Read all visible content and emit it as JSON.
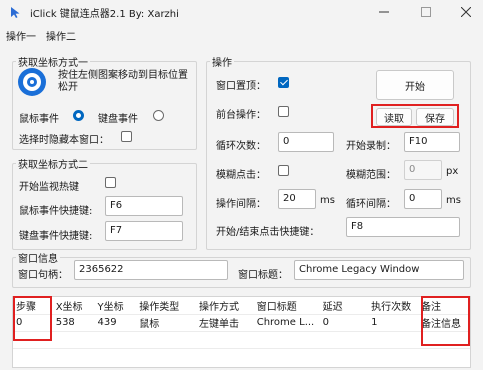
{
  "window": {
    "title": "iClick 键鼠连点器2.1 By:  Xarzhi"
  },
  "menu": [
    "操作一",
    "操作二"
  ],
  "coord_group1": {
    "legend": "获取坐标方式一",
    "drag_hint": "按住左侧图案移动到目标位置松开",
    "mouse_event_label": "鼠标事件",
    "keyboard_event_label": "键盘事件",
    "hide_window_label": "选择时隐藏本窗口：",
    "mouse_event_selected": true,
    "keyboard_event_selected": false,
    "hide_window_checked": false
  },
  "coord_group2": {
    "legend": "获取坐标方式二",
    "start_monitor_label": "开始监视热键",
    "start_monitor_checked": false,
    "mouse_hotkey_label": "鼠标事件快捷键:",
    "mouse_hotkey_value": "F6",
    "keyboard_hotkey_label": "键盘事件快捷键:",
    "keyboard_hotkey_value": "F7"
  },
  "operation": {
    "legend": "操作",
    "topmost_label": "窗口置顶：",
    "topmost_checked": true,
    "foreground_label": "前台操作：",
    "foreground_checked": false,
    "start_button": "开始",
    "read_button": "读取",
    "save_button": "保存",
    "loop_count_label": "循环次数：",
    "loop_count_value": "0",
    "start_record_label": "开始录制：",
    "start_record_value": "F10",
    "fuzzy_click_label": "模糊点击：",
    "fuzzy_click_checked": false,
    "fuzzy_range_label": "模糊范围：",
    "fuzzy_range_value": "0",
    "fuzzy_range_unit": "px",
    "interval_label": "操作间隔：",
    "interval_value": "20",
    "interval_unit": "ms",
    "loop_interval_label": "循环间隔：",
    "loop_interval_value": "0",
    "loop_interval_unit": "ms",
    "start_stop_hotkey_label": "开始/结束点击快捷键：",
    "start_stop_hotkey_value": "F8"
  },
  "window_info": {
    "legend": "窗口信息",
    "handle_label": "窗口句柄：",
    "handle_value": "2365622",
    "title_label": "窗口标题：",
    "title_value": "Chrome Legacy Window"
  },
  "table": {
    "columns": [
      "步骤",
      "X坐标",
      "Y坐标",
      "操作类型",
      "操作方式",
      "窗口标题",
      "延迟",
      "执行次数",
      "备注"
    ],
    "rows": [
      [
        "0",
        "538",
        "439",
        "鼠标",
        "左键单击",
        "Chrome L...",
        "0",
        "1",
        "备注信息"
      ]
    ]
  },
  "colors": {
    "accent": "#0067c0",
    "highlight": "#e02020"
  }
}
